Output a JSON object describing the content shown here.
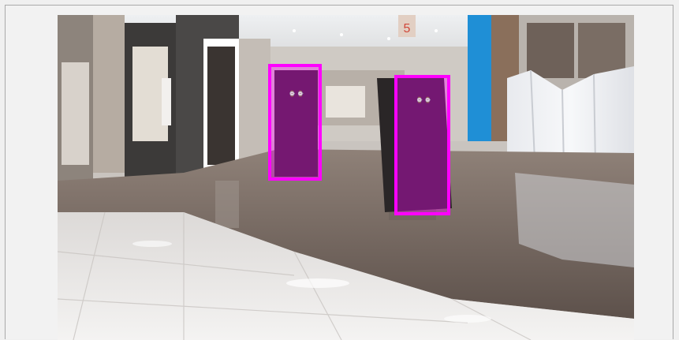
{
  "image": {
    "subject": "shopping-mall-corridor",
    "store_sign_number": "5"
  },
  "detections": [
    {
      "label": "",
      "color": "#ff00ff"
    },
    {
      "label": "",
      "color": "#ff00ff"
    }
  ],
  "colors": {
    "highlight": "#ff00ff",
    "frame_border": "#a9a9a9",
    "background": "#f0f0f0"
  }
}
